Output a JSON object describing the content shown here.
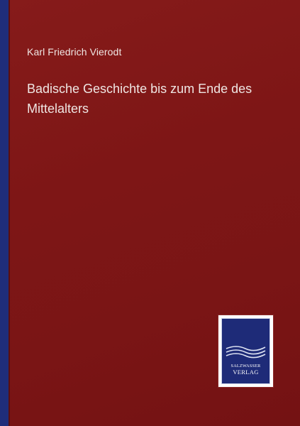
{
  "cover": {
    "author": "Karl Friedrich Vierodt",
    "title": "Badische Geschichte bis zum Ende des Mittelalters"
  },
  "publisher_logo": {
    "line1": "SALZWASSER",
    "line2": "VERLAG",
    "icon": "ship-waves-icon"
  },
  "colors": {
    "cover_red": "#7e1616",
    "spine_blue": "#1f2d7a",
    "logo_blue": "#1e2b78",
    "text_light": "#efe6e3"
  }
}
